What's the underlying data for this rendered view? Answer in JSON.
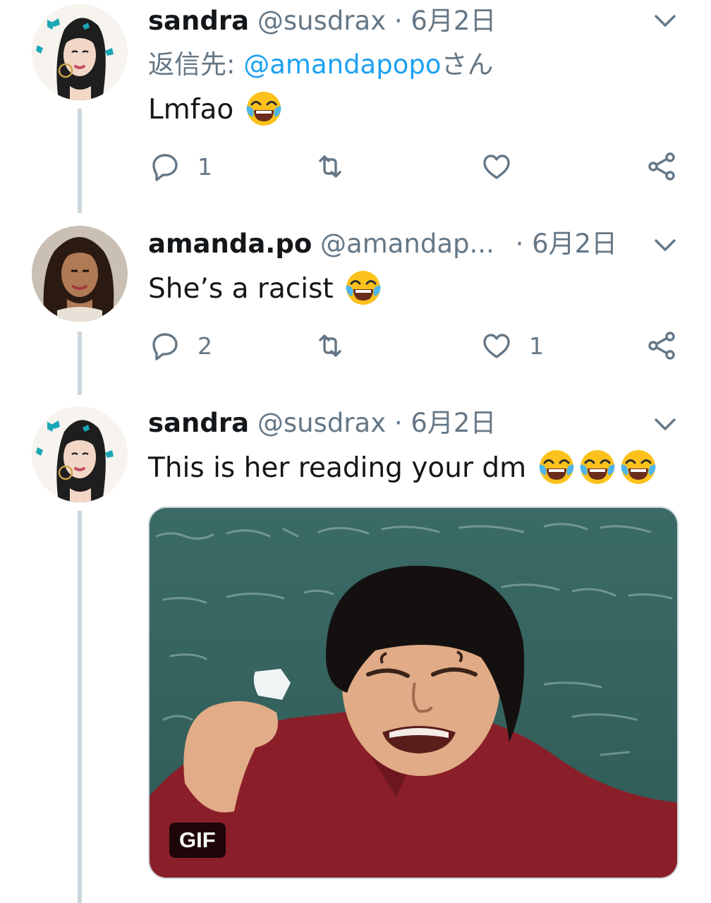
{
  "tweets": [
    {
      "display_name": "sandra",
      "handle": "@susdrax",
      "separator": "·",
      "date": "6月2日",
      "reply_prefix": "返信先: ",
      "reply_mention": "@amandapopo",
      "reply_suffix": "さん",
      "text": "Lmfao",
      "emoji": "face-with-tears-of-joy",
      "reply_count": "1",
      "retweet_count": "",
      "like_count": ""
    },
    {
      "display_name": "amanda.po",
      "handle": "@amandap...",
      "separator": "·",
      "date": "6月2日",
      "text": "She’s a racist",
      "emoji": "face-with-tears-of-joy",
      "reply_count": "2",
      "retweet_count": "",
      "like_count": "1"
    },
    {
      "display_name": "sandra",
      "handle": "@susdrax",
      "separator": "·",
      "date": "6月2日",
      "text": "This is her reading your dm",
      "emoji": "face-with-tears-of-joy x3",
      "media_badge": "GIF"
    }
  ],
  "colors": {
    "text": "#14171a",
    "secondary": "#657786",
    "link": "#1da1f2",
    "thread_line": "#ccd6dd"
  },
  "icons": [
    "reply-icon",
    "retweet-icon",
    "like-icon",
    "share-icon",
    "chevron-down-icon"
  ]
}
